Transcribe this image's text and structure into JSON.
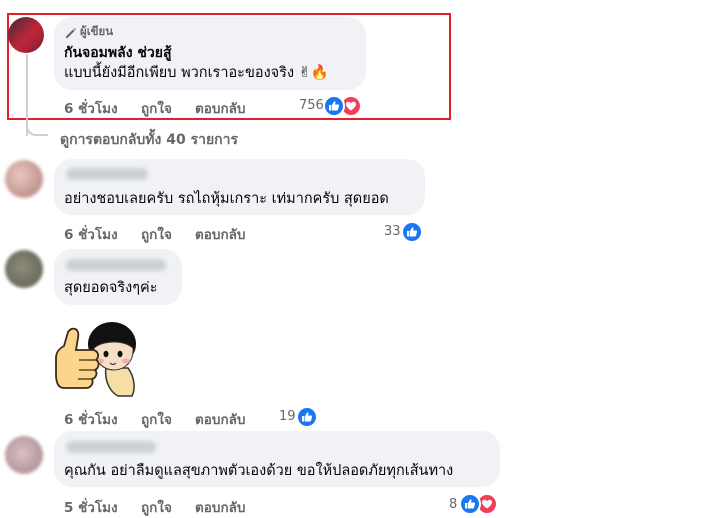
{
  "comments": [
    {
      "badge": "ผู้เขียน",
      "author": "กันจอมพลัง ช่วยสู้",
      "text": "แบบนี้ยังมีอีกเพียบ พวกเราอะของจริง ✌🔥",
      "time": "6 ชั่วโมง",
      "like": "ถูกใจ",
      "reply": "ตอบกลับ",
      "count": "756",
      "reactions": [
        "like-icon",
        "love-icon"
      ],
      "highlighted": true
    },
    {
      "text": "อย่างชอบเลยครับ รถไถหุ้มเกราะ เท่มากครับ สุดยอด",
      "time": "6 ชั่วโมง",
      "like": "ถูกใจ",
      "reply": "ตอบกลับ",
      "count": "33",
      "reactions": [
        "like-icon"
      ]
    },
    {
      "text": "สุดยอดจริงๆค่ะ",
      "sticker": "thumbs-up-sticker",
      "time": "6 ชั่วโมง",
      "like": "ถูกใจ",
      "reply": "ตอบกลับ",
      "count": "19",
      "reactions": [
        "like-icon"
      ]
    },
    {
      "text": "คุณกัน อย่าลืมดูแลสุขภาพตัวเองด้วย ขอให้ปลอดภัยทุกเส้นทาง",
      "time": "5 ชั่วโมง",
      "like": "ถูกใจ",
      "reply": "ตอบกลับ",
      "count": "8",
      "reactions": [
        "like-icon",
        "love-icon"
      ]
    }
  ],
  "view_replies": "ดูการตอบกลับทั้ง 40 รายการ",
  "colors": {
    "highlight_border": "#e41e2b",
    "bubble_bg": "#f0f2f5",
    "meta_text": "#65676b",
    "like_blue": "#1877f2",
    "love_red": "#f33e58"
  }
}
